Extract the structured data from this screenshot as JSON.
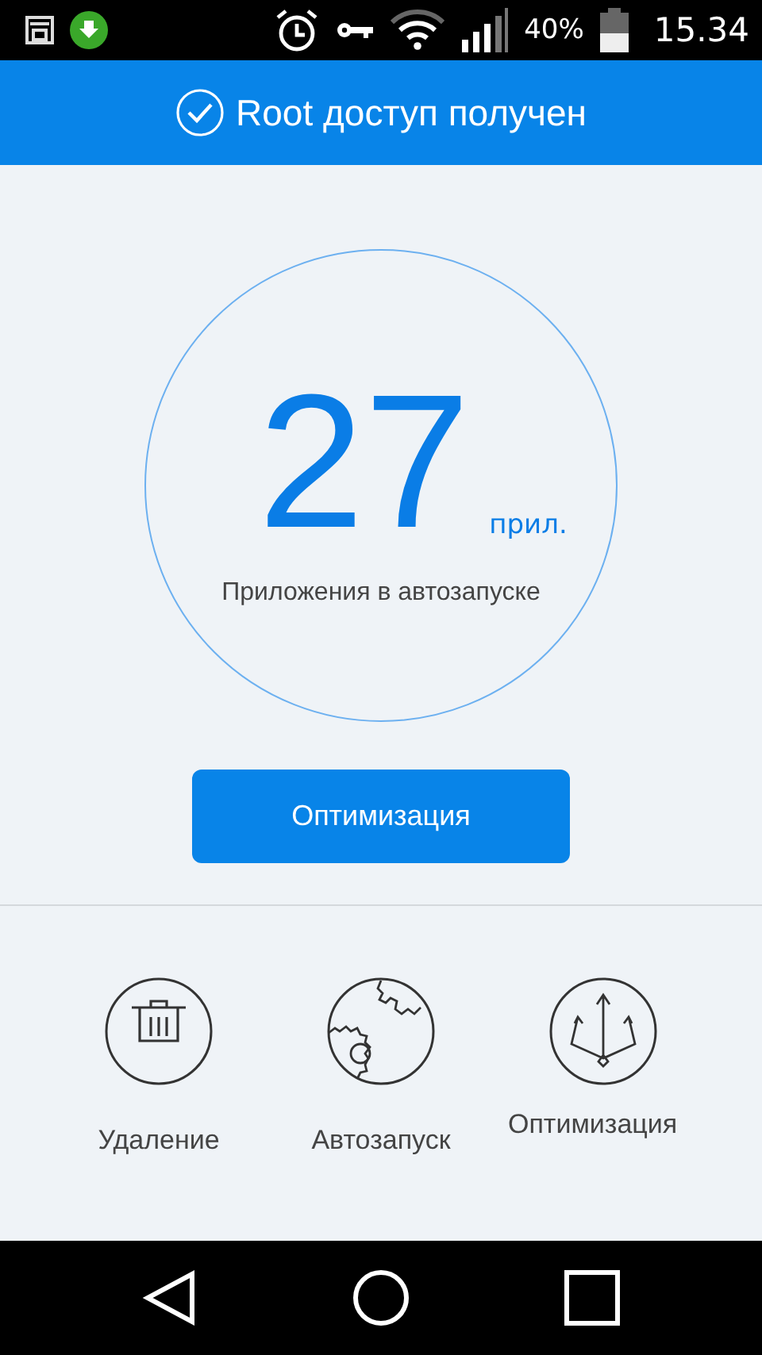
{
  "status_bar": {
    "battery": "40%",
    "time": "15.34"
  },
  "header": {
    "title": "Root доступ получен"
  },
  "counter": {
    "value": "27",
    "unit": "прил.",
    "caption": "Приложения в автозапуске"
  },
  "optimize_button": {
    "label": "Оптимизация"
  },
  "tools": [
    {
      "kind": "trash",
      "label": "Удаление"
    },
    {
      "kind": "gears",
      "label": "Автозапуск"
    },
    {
      "kind": "trident",
      "label": "Оптимизация"
    }
  ]
}
